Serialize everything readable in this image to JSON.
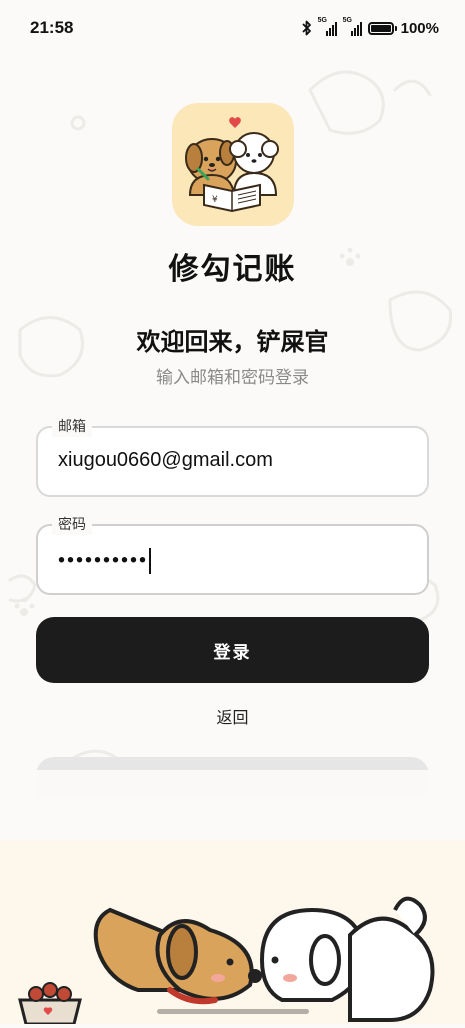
{
  "status_bar": {
    "time": "21:58",
    "bluetooth_icon": "bluetooth-icon",
    "signal_1_tag": "5G",
    "signal_2_tag": "5G",
    "battery_percent": "100%"
  },
  "app": {
    "logo_icon": "dog-couple-ledger-logo",
    "name": "修勾记账"
  },
  "header": {
    "welcome": "欢迎回来，铲屎官",
    "subtitle": "输入邮箱和密码登录"
  },
  "form": {
    "email_label": "邮箱",
    "email_value": "xiugou0660@gmail.com",
    "password_label": "密码",
    "password_masked": "••••••••••",
    "login_label": "登录",
    "back_label": "返回"
  },
  "colors": {
    "background": "#fbfaf8",
    "logo_bg": "#fbe7b8",
    "primary_button": "#1c1c1c",
    "field_border": "#d9d9d9",
    "subtitle_text": "#8a8a8a"
  }
}
